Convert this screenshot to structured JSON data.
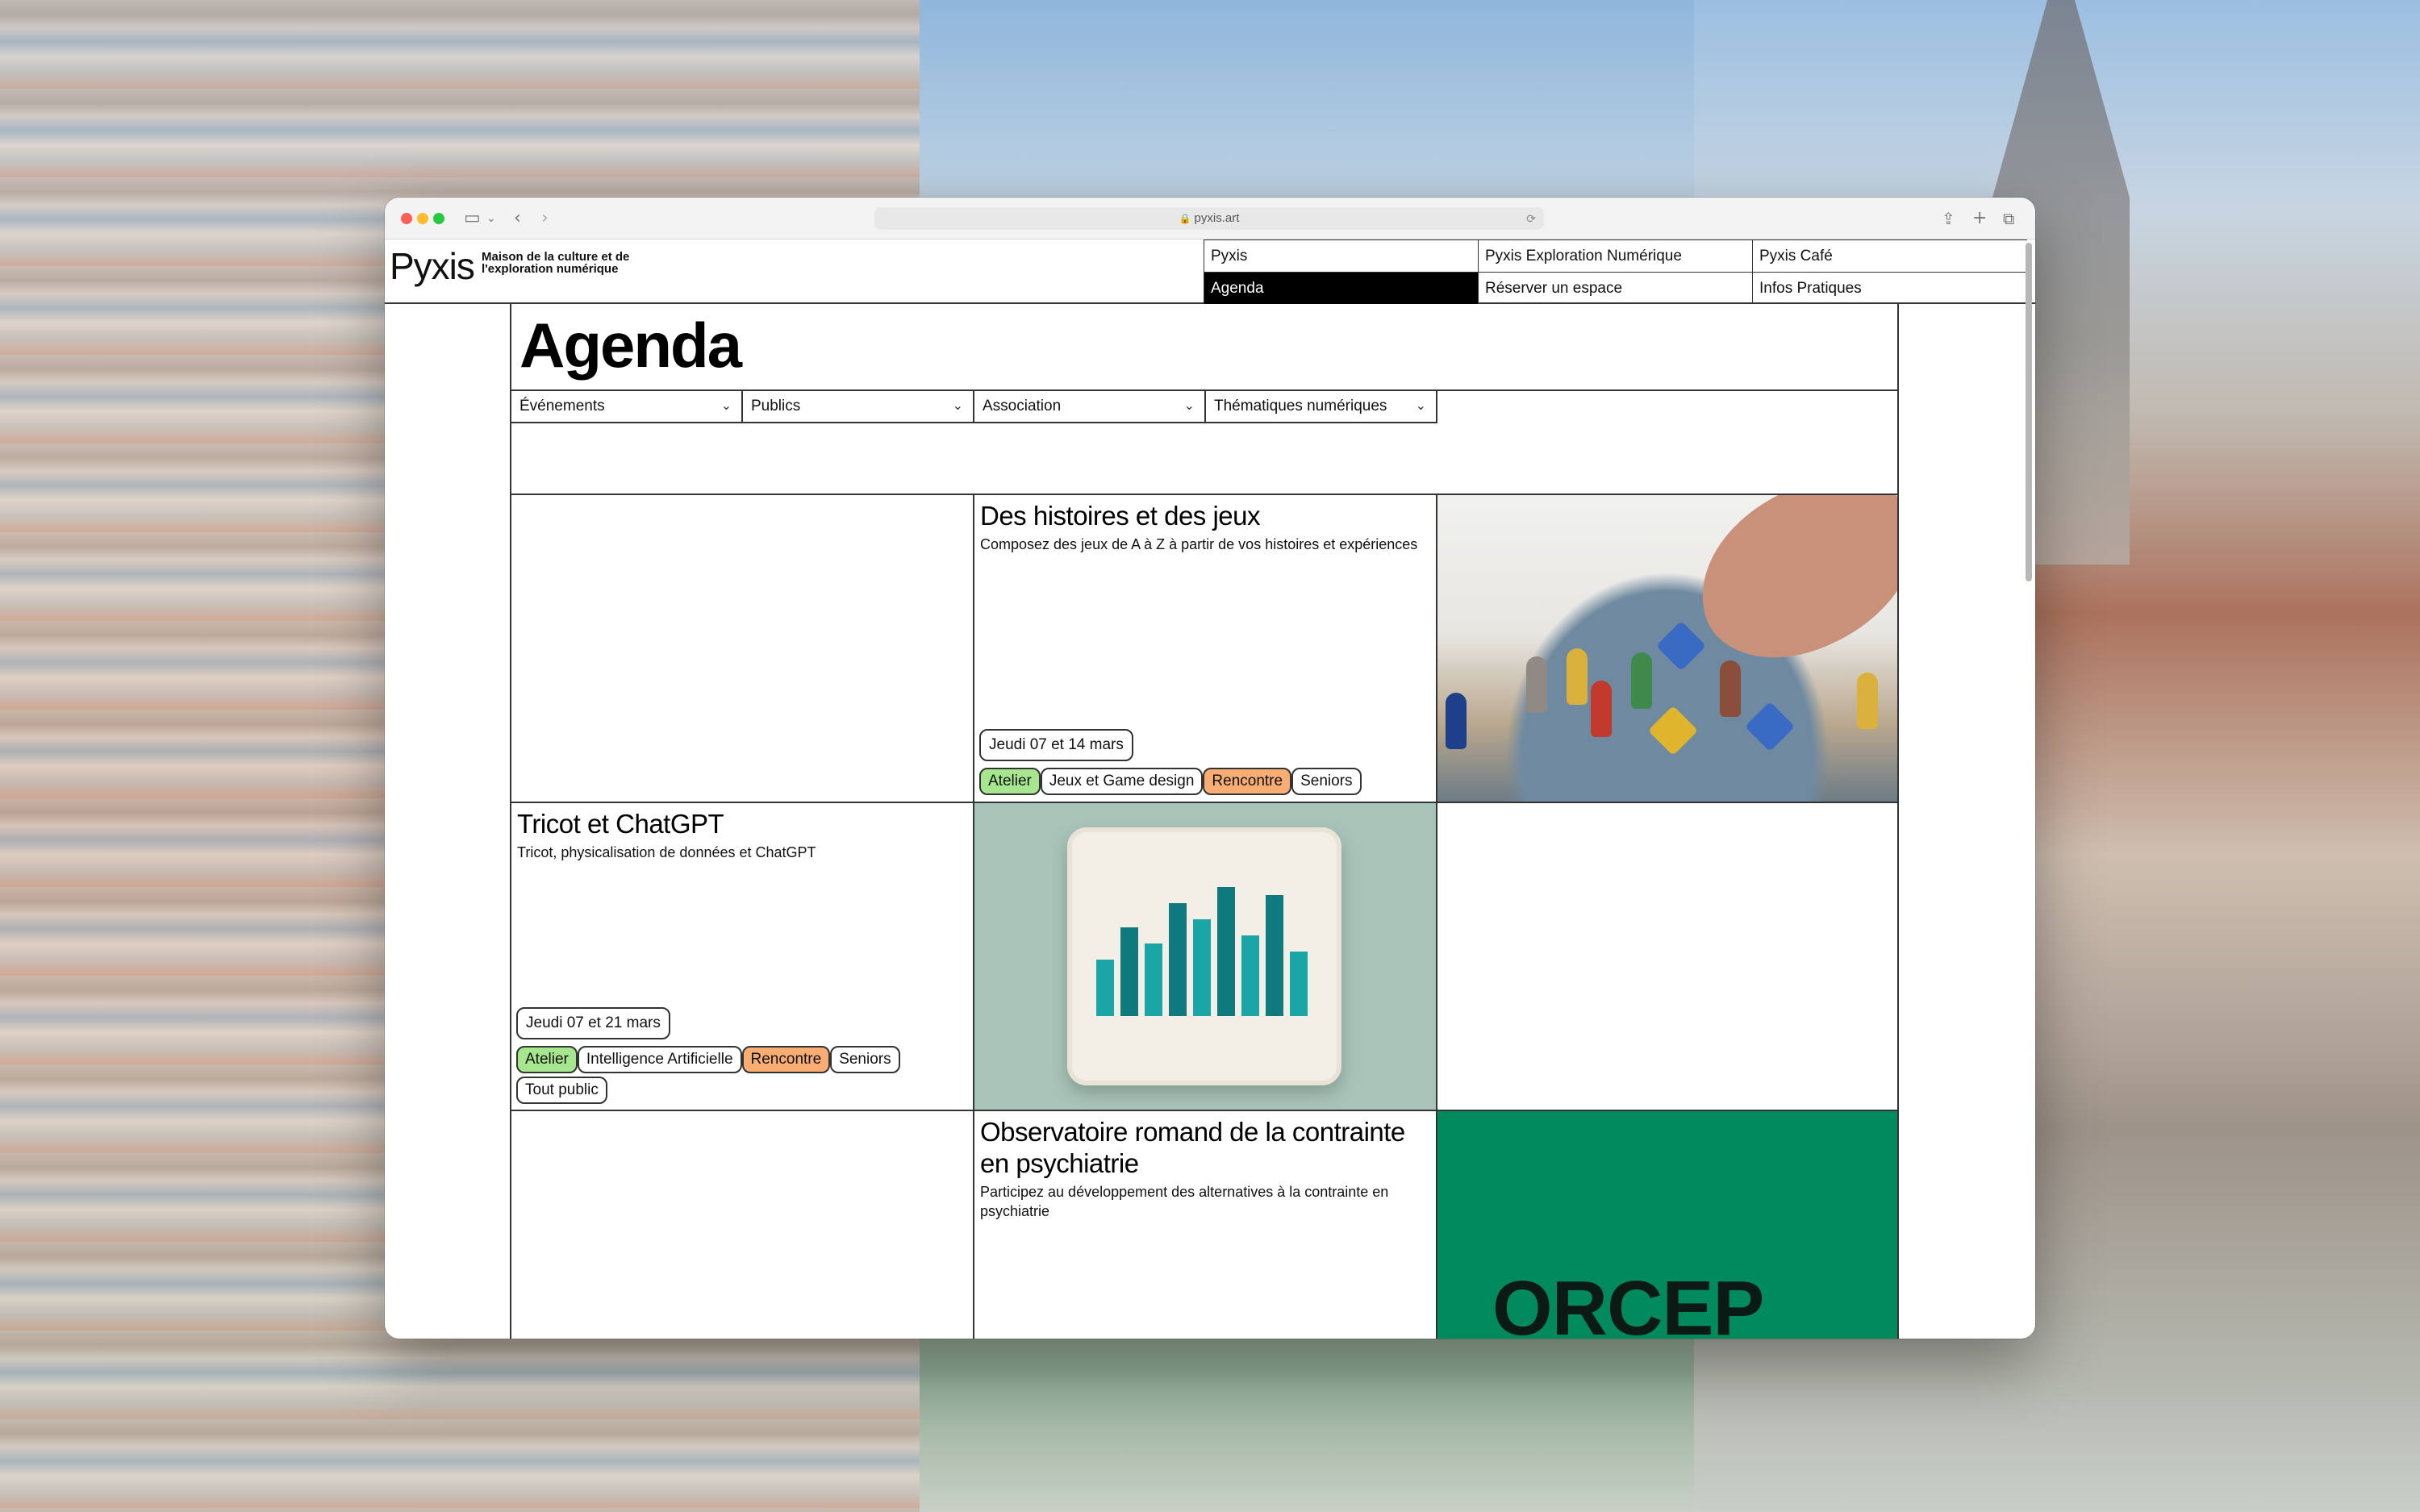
{
  "browser": {
    "url": "pyxis.art"
  },
  "site": {
    "logo": "Pyxis",
    "tagline": "Maison de la culture et de l'exploration numérique",
    "nav": [
      {
        "label": "Pyxis",
        "active": false
      },
      {
        "label": "Pyxis Exploration Numérique",
        "active": false
      },
      {
        "label": "Pyxis Café",
        "active": false
      },
      {
        "label": "Agenda",
        "active": true
      },
      {
        "label": "Réserver un espace",
        "active": false
      },
      {
        "label": "Infos Pratiques",
        "active": false
      }
    ]
  },
  "agenda": {
    "title": "Agenda",
    "filters": [
      {
        "label": "Événements"
      },
      {
        "label": "Publics"
      },
      {
        "label": "Association"
      },
      {
        "label": "Thématiques numériques"
      }
    ]
  },
  "events": [
    {
      "title": "Des histoires et des jeux",
      "subtitle": "Composez des jeux de A à Z à partir de vos histoires et expériences",
      "date": "Jeudi 07 et 14 mars",
      "tags": [
        {
          "label": "Atelier",
          "color": "#a6e68e"
        },
        {
          "label": "Jeux et Game design",
          "color": "#ffffff"
        },
        {
          "label": "Rencontre",
          "color": "#f8ad73"
        },
        {
          "label": "Seniors",
          "color": "#ffffff"
        }
      ]
    },
    {
      "title": "Tricot et ChatGPT",
      "subtitle": "Tricot, physicalisation de données et ChatGPT",
      "date": "Jeudi 07 et 21 mars",
      "tags": [
        {
          "label": "Atelier",
          "color": "#a6e68e"
        },
        {
          "label": "Intelligence Artificielle",
          "color": "#ffffff"
        },
        {
          "label": "Rencontre",
          "color": "#f8ad73"
        },
        {
          "label": "Seniors",
          "color": "#ffffff"
        },
        {
          "label": "Tout public",
          "color": "#ffffff"
        }
      ]
    },
    {
      "title": "Observatoire romand de la contrainte en psychiatrie",
      "subtitle": "Participez au développement des alternatives à la contrainte en psychiatrie",
      "image_text": "ORCEP"
    }
  ]
}
